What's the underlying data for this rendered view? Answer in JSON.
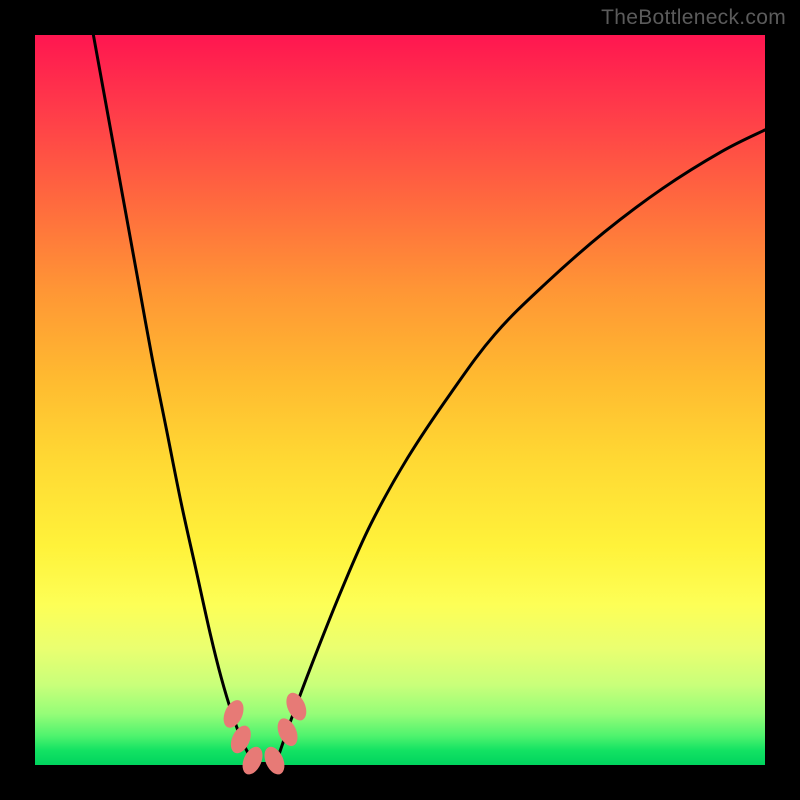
{
  "watermark": "TheBottleneck.com",
  "chart_data": {
    "type": "line",
    "title": "",
    "xlabel": "",
    "ylabel": "",
    "xlim": [
      0,
      100
    ],
    "ylim": [
      0,
      100
    ],
    "grid": false,
    "legend": false,
    "series": [
      {
        "name": "left-branch",
        "x": [
          8,
          10,
          12,
          14,
          16,
          18,
          20,
          22,
          24,
          25.5,
          27,
          28.5,
          30
        ],
        "values": [
          100,
          89,
          78,
          67,
          56,
          46,
          36,
          27,
          18,
          12,
          7,
          3,
          0
        ]
      },
      {
        "name": "right-branch",
        "x": [
          33,
          35,
          38,
          42,
          46,
          51,
          57,
          63,
          70,
          78,
          86,
          94,
          100
        ],
        "values": [
          0,
          6,
          14,
          24,
          33,
          42,
          51,
          59,
          66,
          73,
          79,
          84,
          87
        ]
      }
    ],
    "flat_bottom": {
      "x_from": 30,
      "x_to": 33,
      "value": 0
    },
    "markers": [
      {
        "x": 27.2,
        "y": 7.0
      },
      {
        "x": 28.2,
        "y": 3.5
      },
      {
        "x": 29.8,
        "y": 0.6
      },
      {
        "x": 32.8,
        "y": 0.6
      },
      {
        "x": 34.6,
        "y": 4.5
      },
      {
        "x": 35.8,
        "y": 8.0
      }
    ],
    "marker_size": {
      "rx": 1.2,
      "ry": 2.0,
      "rotation": 24
    },
    "colors": {
      "curve": "#000000",
      "marker": "#e77a76",
      "gradient_top": "#ff1650",
      "gradient_bottom": "#00d45e"
    }
  }
}
